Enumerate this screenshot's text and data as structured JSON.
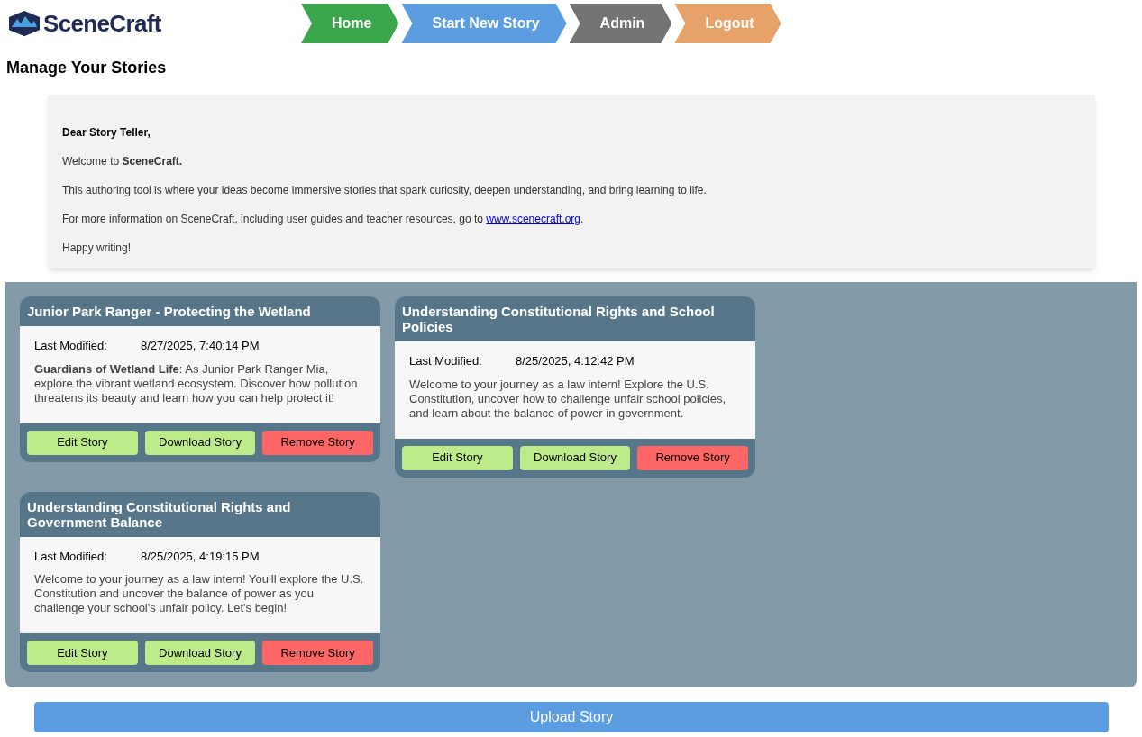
{
  "brand": {
    "name": "SceneCraft"
  },
  "nav": [
    {
      "label": "Home",
      "color": "#3aa74c"
    },
    {
      "label": "Start New Story",
      "color": "#5b9de0"
    },
    {
      "label": "Admin",
      "color": "#747474"
    },
    {
      "label": "Logout",
      "color": "#e6a268"
    }
  ],
  "page_title": "Manage Your Stories",
  "welcome": {
    "greeting": "Dear Story Teller,",
    "intro": "Welcome to **SceneCraft.**",
    "body": "This authoring tool is where your ideas become immersive stories that spark curiosity, deepen understanding, and bring learning to life.",
    "info": {
      "text": "For more information on SceneCraft, including user guides and teacher resources, go to",
      "link": "www.scenecraft.org",
      "suffix": "."
    },
    "closing": "Happy writing!"
  },
  "stories": [
    {
      "title": "Junior Park Ranger - Protecting the Wetland",
      "modified_label": "Last Modified:",
      "modified": "8/27/2025, 7:40:14 PM",
      "description": "**Guardians of Wetland Life**: As Junior Park Ranger Mia, explore the vibrant wetland ecosystem. Discover how pollution threatens its beauty and learn how you can help protect it!",
      "actions": [
        {
          "kind": "edit",
          "label": "Edit Story"
        },
        {
          "kind": "download",
          "label": "Download Story"
        },
        {
          "kind": "remove",
          "label": "Remove Story"
        }
      ]
    },
    {
      "title": "Understanding Constitutional Rights and School Policies",
      "modified_label": "Last Modified:",
      "modified": "8/25/2025, 4:12:42 PM",
      "description": "Welcome to your journey as a law intern! Explore the U.S. Constitution, uncover how to challenge unfair school policies, and learn about the balance of power in government.",
      "actions": [
        {
          "kind": "edit",
          "label": "Edit Story"
        },
        {
          "kind": "download",
          "label": "Download Story"
        },
        {
          "kind": "remove",
          "label": "Remove Story"
        }
      ]
    },
    {
      "title": "Understanding Constitutional Rights and Government Balance",
      "modified_label": "Last Modified:",
      "modified": "8/25/2025, 4:19:15 PM",
      "description": "Welcome to your journey as a law intern! You’ll explore the U.S. Constitution and uncover the balance of power as you challenge your school's unfair policy. Let's begin!",
      "actions": [
        {
          "kind": "edit",
          "label": "Edit Story"
        },
        {
          "kind": "download",
          "label": "Download Story"
        },
        {
          "kind": "remove",
          "label": "Remove Story"
        }
      ]
    }
  ],
  "upload_button": "Upload Story"
}
